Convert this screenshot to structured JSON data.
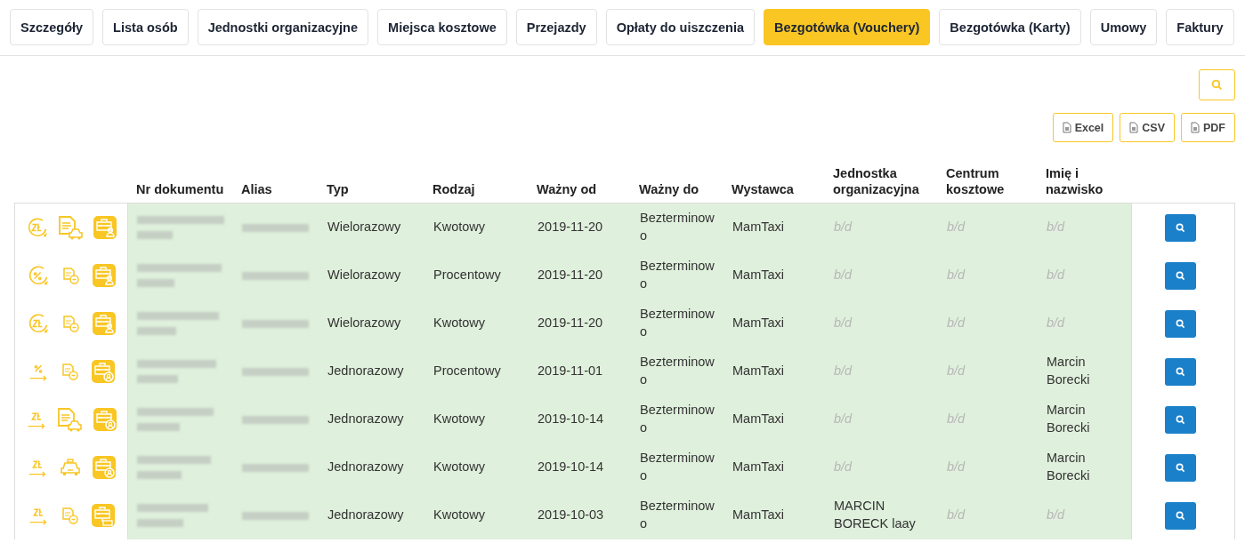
{
  "tabs": [
    {
      "label": "Szczegóły",
      "selected": false
    },
    {
      "label": "Lista osób",
      "selected": false
    },
    {
      "label": "Jednostki organizacyjne",
      "selected": false
    },
    {
      "label": "Miejsca kosztowe",
      "selected": false
    },
    {
      "label": "Przejazdy",
      "selected": false
    },
    {
      "label": "Opłaty do uiszczenia",
      "selected": false
    },
    {
      "label": "Bezgotówka (Vouchery)",
      "selected": true
    },
    {
      "label": "Bezgotówka (Karty)",
      "selected": false
    },
    {
      "label": "Umowy",
      "selected": false
    },
    {
      "label": "Faktury",
      "selected": false
    }
  ],
  "export_buttons": [
    "Excel",
    "CSV",
    "PDF"
  ],
  "table": {
    "columns": [
      "Nr dokumentu",
      "Alias",
      "Typ",
      "Rodzaj",
      "Ważny od",
      "Ważny do",
      "Wystawca",
      "Jednostka organizacyjna",
      "Centrum kosztowe",
      "Imię i nazwisko"
    ],
    "rows": [
      {
        "icons": [
          {
            "kind": "zl-cycle"
          },
          {
            "kind": "document-taxi"
          },
          {
            "kind": "briefcase-person"
          }
        ],
        "typ": "Wielorazowy",
        "rodzaj": "Kwotowy",
        "od": "2019-11-20",
        "do": "Bezterminowo",
        "wystawca": "MamTaxi",
        "jednostka": "b/d",
        "centrum": "b/d",
        "osoba": "b/d"
      },
      {
        "icons": [
          {
            "kind": "percent-cycle"
          },
          {
            "kind": "document-minus"
          },
          {
            "kind": "briefcase-person"
          }
        ],
        "typ": "Wielorazowy",
        "rodzaj": "Procentowy",
        "od": "2019-11-20",
        "do": "Bezterminowo",
        "wystawca": "MamTaxi",
        "jednostka": "b/d",
        "centrum": "b/d",
        "osoba": "b/d"
      },
      {
        "icons": [
          {
            "kind": "zl-cycle"
          },
          {
            "kind": "document-minus"
          },
          {
            "kind": "briefcase-person"
          }
        ],
        "typ": "Wielorazowy",
        "rodzaj": "Kwotowy",
        "od": "2019-11-20",
        "do": "Bezterminowo",
        "wystawca": "MamTaxi",
        "jednostka": "b/d",
        "centrum": "b/d",
        "osoba": "b/d"
      },
      {
        "icons": [
          {
            "kind": "percent-arrow"
          },
          {
            "kind": "document-minus"
          },
          {
            "kind": "briefcase-person-circle"
          }
        ],
        "typ": "Jednorazowy",
        "rodzaj": "Procentowy",
        "od": "2019-11-01",
        "do": "Bezterminowo",
        "wystawca": "MamTaxi",
        "jednostka": "b/d",
        "centrum": "b/d",
        "osoba": "Marcin Borecki"
      },
      {
        "icons": [
          {
            "kind": "zl-arrow"
          },
          {
            "kind": "document-taxi"
          },
          {
            "kind": "briefcase-person-circle"
          }
        ],
        "typ": "Jednorazowy",
        "rodzaj": "Kwotowy",
        "od": "2019-10-14",
        "do": "Bezterminowo",
        "wystawca": "MamTaxi",
        "jednostka": "b/d",
        "centrum": "b/d",
        "osoba": "Marcin Borecki"
      },
      {
        "icons": [
          {
            "kind": "zl-arrow"
          },
          {
            "kind": "taxi"
          },
          {
            "kind": "briefcase-person-circle"
          }
        ],
        "typ": "Jednorazowy",
        "rodzaj": "Kwotowy",
        "od": "2019-10-14",
        "do": "Bezterminowo",
        "wystawca": "MamTaxi",
        "jednostka": "b/d",
        "centrum": "b/d",
        "osoba": "Marcin Borecki"
      },
      {
        "icons": [
          {
            "kind": "zl-arrow"
          },
          {
            "kind": "document-minus"
          },
          {
            "kind": "briefcase-card"
          }
        ],
        "typ": "Jednorazowy",
        "rodzaj": "Kwotowy",
        "od": "2019-10-03",
        "do": "Bezterminowo",
        "wystawca": "MamTaxi",
        "jednostka": "MARCIN BORECK laay",
        "centrum": "b/d",
        "osoba": "b/d"
      }
    ]
  }
}
